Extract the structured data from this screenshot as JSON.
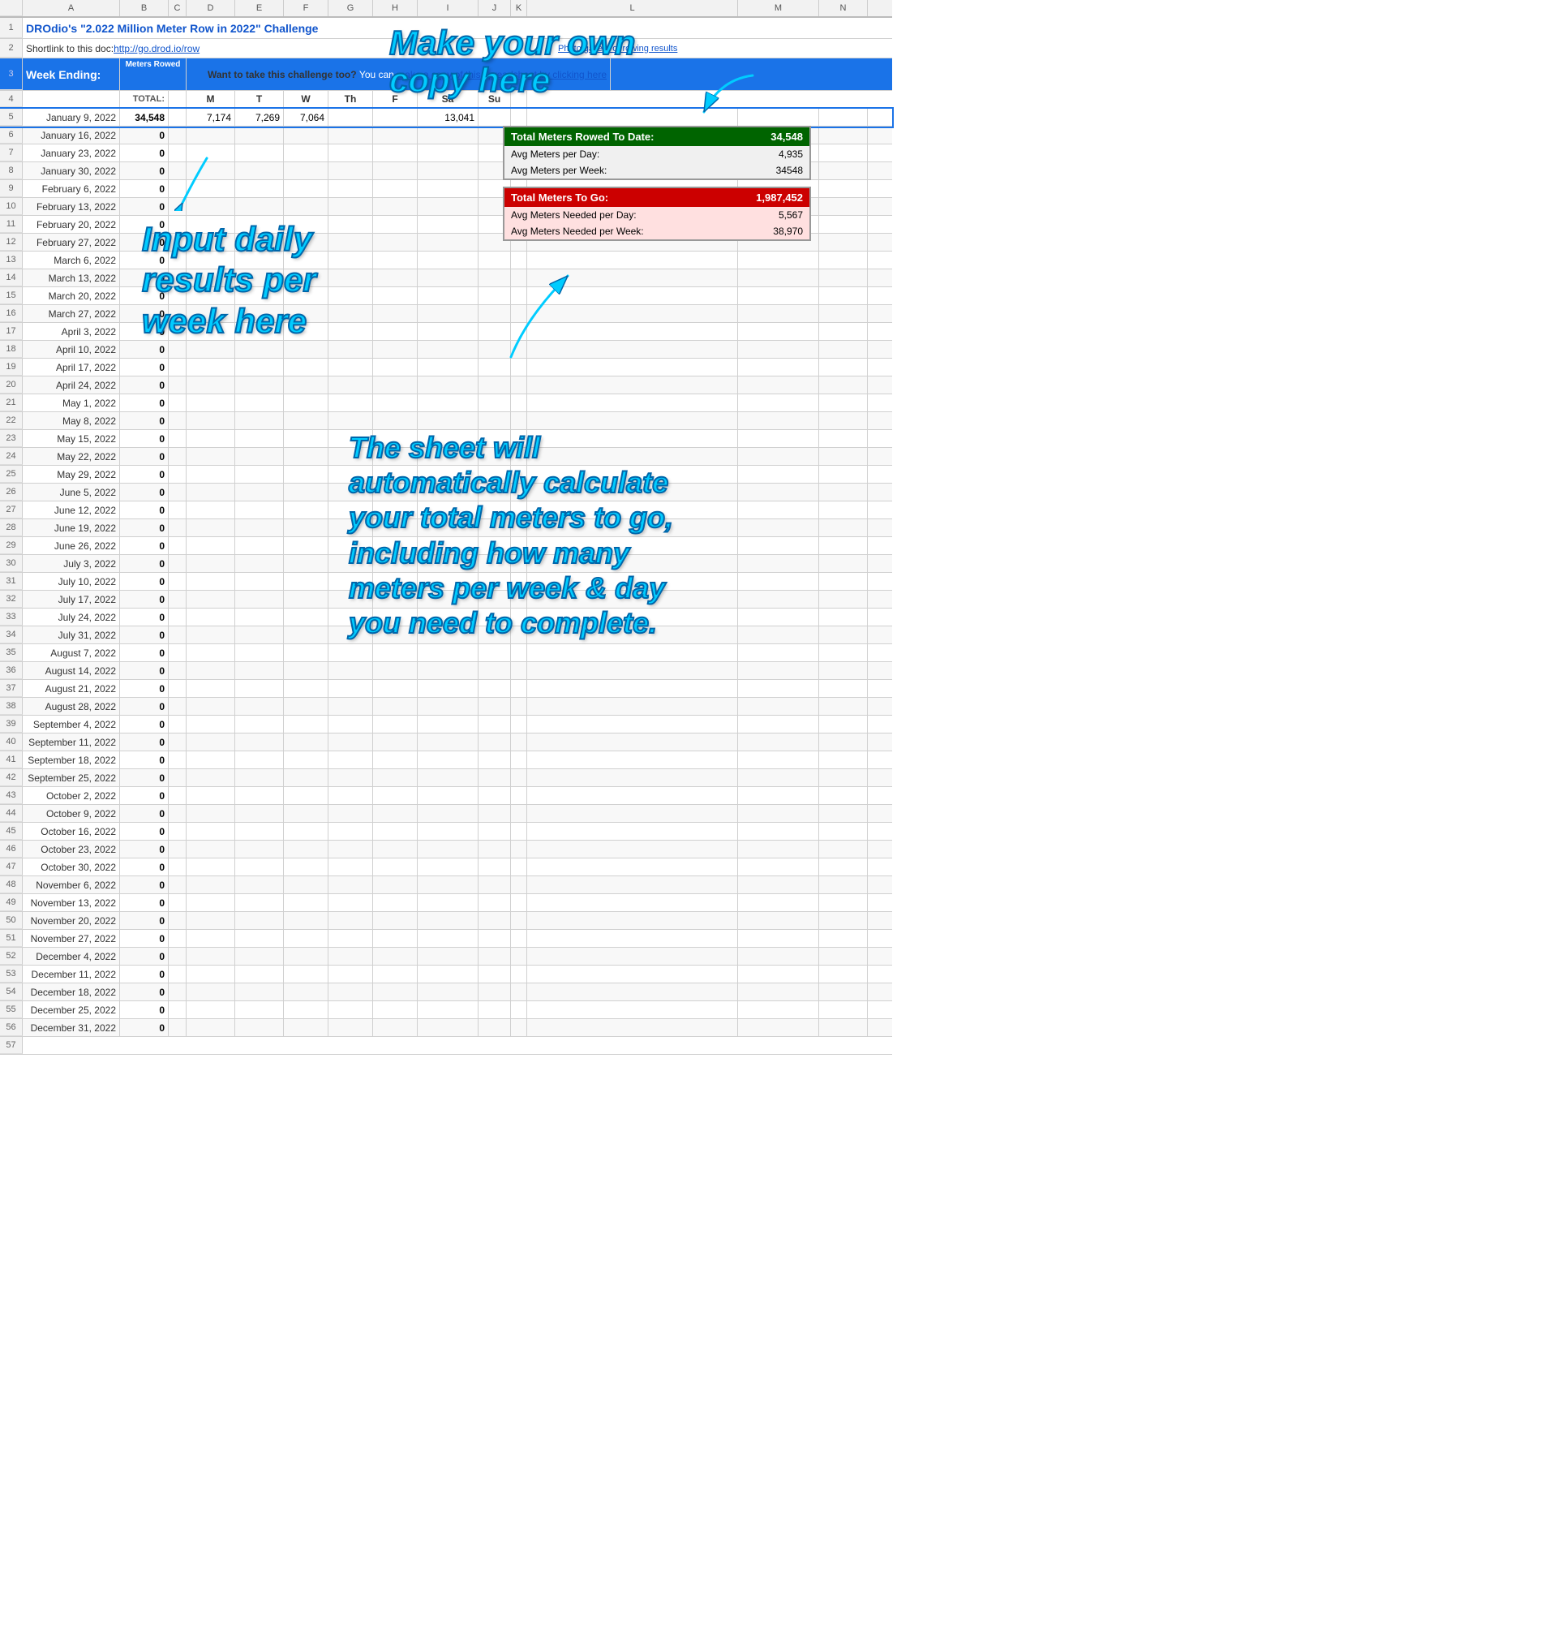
{
  "title": {
    "text": "DROdio's \"2.022 Million Meter Row in 2022\" Challenge",
    "link_text": "http://go.drod.io/row",
    "shortlink_prefix": "Shortlink to this doc: ",
    "photo_gallery": "Photo gallery of rowing results"
  },
  "header": {
    "week_ending": "Week Ending:",
    "meters_rowed": "Meters Rowed",
    "total_label": "TOTAL:",
    "want_to_take": "Want to take this challenge too?",
    "make_copy_text": "You can",
    "make_copy_link": "make a copy of this spreadsheet by clicking here",
    "days": [
      "M",
      "T",
      "W",
      "Th",
      "F",
      "Sa",
      "Su"
    ]
  },
  "annotations": {
    "make_copy": "Make your own\ncopy here",
    "input_daily": "Input daily\nresults per\nweek here",
    "sheet_will": "The sheet will\nautomatically calculate\nyour total meters to go,\nincluding how many\nmeters per week & day\nyou need to complete."
  },
  "stats": {
    "green_box": {
      "label": "Total Meters Rowed To Date:",
      "value": "34,548",
      "rows": [
        {
          "label": "Avg Meters per Day:",
          "value": "4,935"
        },
        {
          "label": "Avg Meters per Week:",
          "value": "34548"
        }
      ]
    },
    "red_box": {
      "label": "Total Meters To Go:",
      "value": "1,987,452",
      "rows": [
        {
          "label": "Avg Meters Needed per Day:",
          "value": "5,567"
        },
        {
          "label": "Avg Meters Needed per Week:",
          "value": "38,970"
        }
      ]
    }
  },
  "col_headers": [
    "A",
    "B",
    "C",
    "D",
    "E",
    "F",
    "G",
    "H",
    "I",
    "J",
    "K",
    "L",
    "M",
    "N"
  ],
  "rows": [
    {
      "num": 5,
      "date": "January 9, 2022",
      "total": "34,548",
      "mon": "7,174",
      "tue": "7,269",
      "wed": "7,064",
      "thu": "",
      "fri": "",
      "sat": "13,041",
      "sun": ""
    },
    {
      "num": 6,
      "date": "January 16, 2022",
      "total": "0",
      "mon": "",
      "tue": "",
      "wed": "",
      "thu": "",
      "fri": "",
      "sat": "",
      "sun": ""
    },
    {
      "num": 7,
      "date": "January 23, 2022",
      "total": "0"
    },
    {
      "num": 8,
      "date": "January 30, 2022",
      "total": "0"
    },
    {
      "num": 9,
      "date": "February 6, 2022",
      "total": "0"
    },
    {
      "num": 10,
      "date": "February 13, 2022",
      "total": "0"
    },
    {
      "num": 11,
      "date": "February 20, 2022",
      "total": "0"
    },
    {
      "num": 12,
      "date": "February 27, 2022",
      "total": "0"
    },
    {
      "num": 13,
      "date": "March 6, 2022",
      "total": "0"
    },
    {
      "num": 14,
      "date": "March 13, 2022",
      "total": "0"
    },
    {
      "num": 15,
      "date": "March 20, 2022",
      "total": "0"
    },
    {
      "num": 16,
      "date": "March 27, 2022",
      "total": "0"
    },
    {
      "num": 17,
      "date": "April 3, 2022",
      "total": "0"
    },
    {
      "num": 18,
      "date": "April 10, 2022",
      "total": "0"
    },
    {
      "num": 19,
      "date": "April 17, 2022",
      "total": "0"
    },
    {
      "num": 20,
      "date": "April 24, 2022",
      "total": "0"
    },
    {
      "num": 21,
      "date": "May 1, 2022",
      "total": "0"
    },
    {
      "num": 22,
      "date": "May 8, 2022",
      "total": "0"
    },
    {
      "num": 23,
      "date": "May 15, 2022",
      "total": "0"
    },
    {
      "num": 24,
      "date": "May 22, 2022",
      "total": "0"
    },
    {
      "num": 25,
      "date": "May 29, 2022",
      "total": "0"
    },
    {
      "num": 26,
      "date": "June 5, 2022",
      "total": "0"
    },
    {
      "num": 27,
      "date": "June 12, 2022",
      "total": "0"
    },
    {
      "num": 28,
      "date": "June 19, 2022",
      "total": "0"
    },
    {
      "num": 29,
      "date": "June 26, 2022",
      "total": "0"
    },
    {
      "num": 30,
      "date": "July 3, 2022",
      "total": "0"
    },
    {
      "num": 31,
      "date": "July 10, 2022",
      "total": "0"
    },
    {
      "num": 32,
      "date": "July 17, 2022",
      "total": "0"
    },
    {
      "num": 33,
      "date": "July 24, 2022",
      "total": "0"
    },
    {
      "num": 34,
      "date": "July 31, 2022",
      "total": "0"
    },
    {
      "num": 35,
      "date": "August 7, 2022",
      "total": "0"
    },
    {
      "num": 36,
      "date": "August 14, 2022",
      "total": "0"
    },
    {
      "num": 37,
      "date": "August 21, 2022",
      "total": "0"
    },
    {
      "num": 38,
      "date": "August 28, 2022",
      "total": "0"
    },
    {
      "num": 39,
      "date": "September 4, 2022",
      "total": "0"
    },
    {
      "num": 40,
      "date": "September 11, 2022",
      "total": "0"
    },
    {
      "num": 41,
      "date": "September 18, 2022",
      "total": "0"
    },
    {
      "num": 42,
      "date": "September 25, 2022",
      "total": "0"
    },
    {
      "num": 43,
      "date": "October 2, 2022",
      "total": "0"
    },
    {
      "num": 44,
      "date": "October 9, 2022",
      "total": "0"
    },
    {
      "num": 45,
      "date": "October 16, 2022",
      "total": "0"
    },
    {
      "num": 46,
      "date": "October 23, 2022",
      "total": "0"
    },
    {
      "num": 47,
      "date": "October 30, 2022",
      "total": "0"
    },
    {
      "num": 48,
      "date": "November 6, 2022",
      "total": "0"
    },
    {
      "num": 49,
      "date": "November 13, 2022",
      "total": "0"
    },
    {
      "num": 50,
      "date": "November 20, 2022",
      "total": "0"
    },
    {
      "num": 51,
      "date": "November 27, 2022",
      "total": "0"
    },
    {
      "num": 52,
      "date": "December 4, 2022",
      "total": "0"
    },
    {
      "num": 53,
      "date": "December 11, 2022",
      "total": "0"
    },
    {
      "num": 54,
      "date": "December 18, 2022",
      "total": "0"
    },
    {
      "num": 55,
      "date": "December 25, 2022",
      "total": "0"
    },
    {
      "num": 56,
      "date": "December 31, 2022",
      "total": "0"
    }
  ]
}
